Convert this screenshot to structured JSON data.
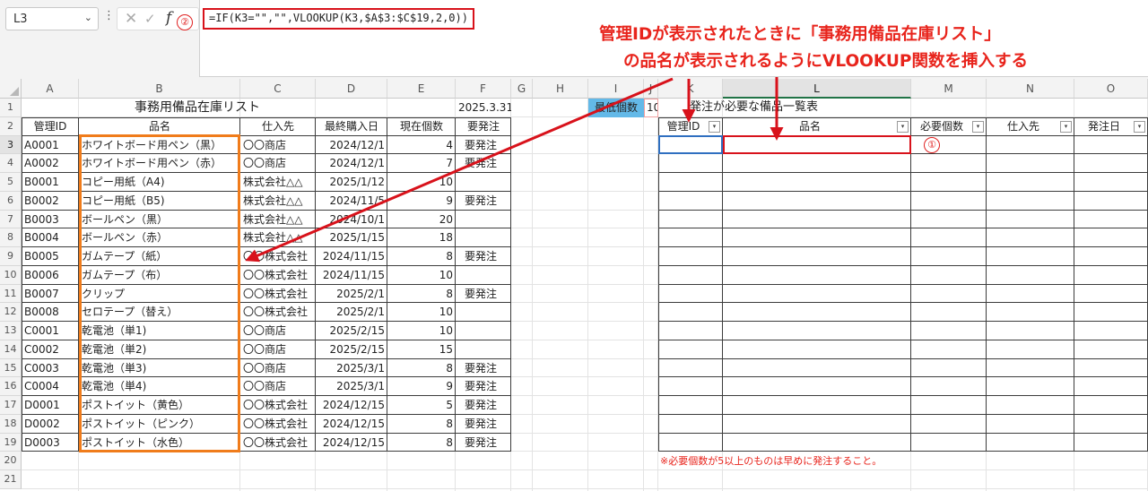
{
  "formula_bar": {
    "name_box": "L3",
    "fx_label": "f",
    "formula": "=IF(K3=\"\",\"\",VLOOKUP(K3,$A$3:$C$19,2,0))",
    "marker_2": "②"
  },
  "annotation": {
    "line1": "管理IDが表示されたときに「事務用備品在庫リスト」",
    "line2": "の品名が表示されるようにVLOOKUP関数を挿入する",
    "marker_1": "①"
  },
  "columns": [
    "A",
    "B",
    "C",
    "D",
    "E",
    "F",
    "G",
    "H",
    "I",
    "J",
    "K",
    "L",
    "M",
    "N",
    "O"
  ],
  "rows": [
    "1",
    "2",
    "3",
    "4",
    "5",
    "6",
    "7",
    "8",
    "9",
    "10",
    "11",
    "12",
    "13",
    "14",
    "15",
    "16",
    "17",
    "18",
    "19",
    "20",
    "21"
  ],
  "inventory": {
    "title": "事務用備品在庫リスト",
    "date": "2025.3.31",
    "min_label": "最低個数",
    "min_value": "10",
    "headers": [
      "管理ID",
      "品名",
      "仕入先",
      "最終購入日",
      "現在個数",
      "要発注"
    ],
    "rows": [
      [
        "A0001",
        "ホワイトボード用ペン（黒）",
        "〇〇商店",
        "2024/12/1",
        "4",
        "要発注"
      ],
      [
        "A0002",
        "ホワイトボード用ペン（赤）",
        "〇〇商店",
        "2024/12/1",
        "7",
        "要発注"
      ],
      [
        "B0001",
        "コピー用紙（A4)",
        "株式会社△△",
        "2025/1/12",
        "10",
        ""
      ],
      [
        "B0002",
        "コピー用紙（B5)",
        "株式会社△△",
        "2024/11/5",
        "9",
        "要発注"
      ],
      [
        "B0003",
        "ボールペン（黒）",
        "株式会社△△",
        "2024/10/1",
        "20",
        ""
      ],
      [
        "B0004",
        "ボールペン（赤）",
        "株式会社△△",
        "2025/1/15",
        "18",
        ""
      ],
      [
        "B0005",
        "ガムテープ（紙）",
        "〇〇株式会社",
        "2024/11/15",
        "8",
        "要発注"
      ],
      [
        "B0006",
        "ガムテープ（布）",
        "〇〇株式会社",
        "2024/11/15",
        "10",
        ""
      ],
      [
        "B0007",
        "クリップ",
        "〇〇株式会社",
        "2025/2/1",
        "8",
        "要発注"
      ],
      [
        "B0008",
        "セロテープ（替え）",
        "〇〇株式会社",
        "2025/2/1",
        "10",
        ""
      ],
      [
        "C0001",
        "乾電池（単1)",
        "〇〇商店",
        "2025/2/15",
        "10",
        ""
      ],
      [
        "C0002",
        "乾電池（単2)",
        "〇〇商店",
        "2025/2/15",
        "15",
        ""
      ],
      [
        "C0003",
        "乾電池（単3)",
        "〇〇商店",
        "2025/3/1",
        "8",
        "要発注"
      ],
      [
        "C0004",
        "乾電池（単4)",
        "〇〇商店",
        "2025/3/1",
        "9",
        "要発注"
      ],
      [
        "D0001",
        "ポストイット（黄色）",
        "〇〇株式会社",
        "2024/12/15",
        "5",
        "要発注"
      ],
      [
        "D0002",
        "ポストイット（ピンク）",
        "〇〇株式会社",
        "2024/12/15",
        "8",
        "要発注"
      ],
      [
        "D0003",
        "ポストイット（水色）",
        "〇〇株式会社",
        "2024/12/15",
        "8",
        "要発注"
      ]
    ]
  },
  "order_list": {
    "title": "発注が必要な備品一覧表",
    "headers": [
      "管理ID",
      "品名",
      "必要個数",
      "仕入先",
      "発注日"
    ],
    "filter_glyph": "▾",
    "note": "※必要個数が5以上のものは早めに発注すること。"
  },
  "colors": {
    "accent_red": "#e8241c",
    "highlight_orange": "#f07c1b",
    "selection_blue": "#2f6fc0",
    "min_label_fill": "#63b9e8"
  }
}
